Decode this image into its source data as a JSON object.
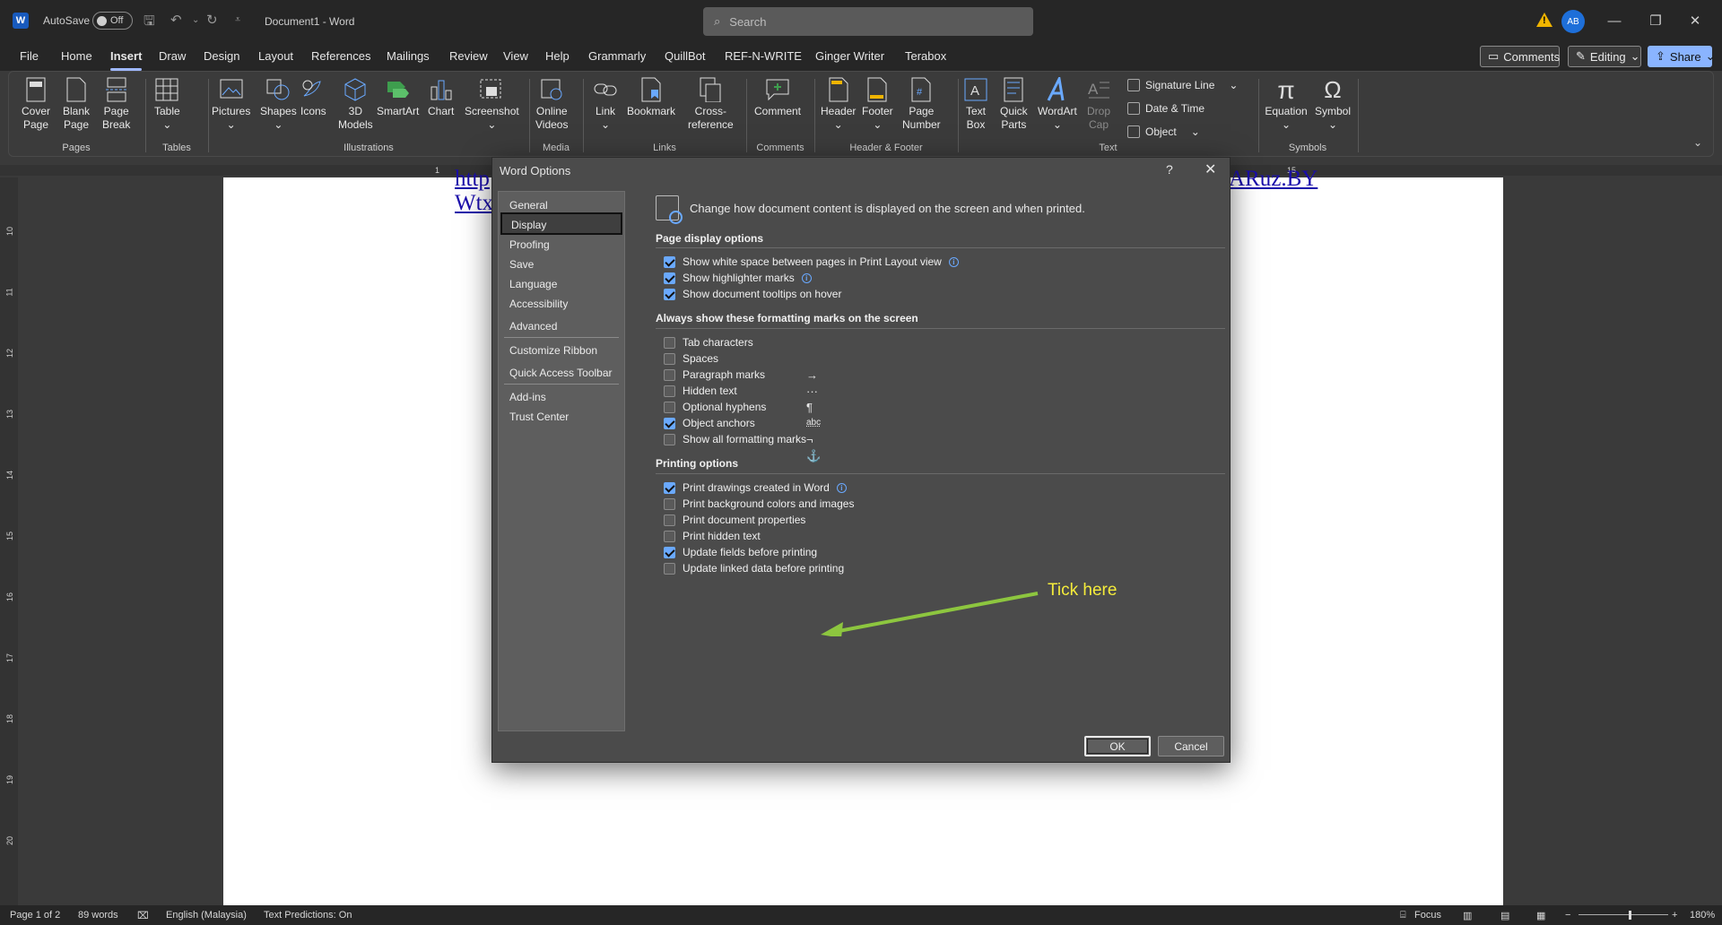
{
  "titlebar": {
    "autosave_label": "AutoSave",
    "autosave_state": "Off",
    "doc_title": "Document1  -  Word",
    "search_placeholder": "Search",
    "user_initials": "AB"
  },
  "menu": [
    "File",
    "Home",
    "Insert",
    "Draw",
    "Design",
    "Layout",
    "References",
    "Mailings",
    "Review",
    "View",
    "Help",
    "Grammarly",
    "QuillBot",
    "REF-N-WRITE",
    "Ginger Writer",
    "Terabox"
  ],
  "menu_active": "Insert",
  "menu_right": {
    "comments": "Comments",
    "editing": "Editing",
    "share": "Share"
  },
  "ribbon": {
    "groups": [
      "Pages",
      "Tables",
      "Illustrations",
      "Media",
      "Links",
      "Comments",
      "Header & Footer",
      "Text",
      "Symbols"
    ],
    "tools": {
      "cover_page": [
        "Cover",
        "Page"
      ],
      "blank_page": [
        "Blank",
        "Page"
      ],
      "page_break": [
        "Page",
        "Break"
      ],
      "table": "Table",
      "pictures": "Pictures",
      "shapes": "Shapes",
      "icons": "Icons",
      "models_3d": [
        "3D",
        "Models"
      ],
      "smartart": "SmartArt",
      "chart": "Chart",
      "screenshot": "Screenshot",
      "online_videos": [
        "Online",
        "Videos"
      ],
      "link": "Link",
      "bookmark": "Bookmark",
      "cross_reference": [
        "Cross-",
        "reference"
      ],
      "comment": "Comment",
      "header": "Header",
      "footer": "Footer",
      "page_number": [
        "Page",
        "Number"
      ],
      "text_box": [
        "Text",
        "Box"
      ],
      "quick_parts": [
        "Quick",
        "Parts"
      ],
      "wordart": "WordArt",
      "drop_cap": [
        "Drop",
        "Cap"
      ],
      "signature_line": "Signature Line",
      "date_time": "Date & Time",
      "object": "Object",
      "equation": "Equation",
      "symbol": "Symbol"
    }
  },
  "ruler": {
    "h_marks": [
      "1",
      "15"
    ],
    "v_marks": [
      "10",
      "11",
      "12",
      "13",
      "14",
      "15",
      "16",
      "17",
      "18",
      "19",
      "20"
    ]
  },
  "document": {
    "line1": "http",
    "line2": "Wtx",
    "line1_right": "ARuz.BY"
  },
  "dialog": {
    "title": "Word Options",
    "help": "?",
    "nav": [
      "General",
      "Display",
      "Proofing",
      "Save",
      "Language",
      "Accessibility",
      "Advanced",
      "Customize Ribbon",
      "Quick Access Toolbar",
      "Add-ins",
      "Trust Center"
    ],
    "nav_selected": "Display",
    "header": "Change how document content is displayed on the screen and when printed.",
    "sections": {
      "page_display": {
        "title": "Page display options",
        "options": [
          {
            "label": "Show white space between pages in Print Layout view",
            "checked": true,
            "info": true
          },
          {
            "label": "Show highlighter marks",
            "checked": true,
            "info": true
          },
          {
            "label": "Show document tooltips on hover",
            "checked": true,
            "info": false
          }
        ]
      },
      "formatting_marks": {
        "title": "Always show these formatting marks on the screen",
        "options": [
          {
            "label": "Tab characters",
            "checked": false,
            "mark": "→"
          },
          {
            "label": "Spaces",
            "checked": false,
            "mark": "···"
          },
          {
            "label": "Paragraph marks",
            "checked": false,
            "mark": "¶"
          },
          {
            "label": "Hidden text",
            "checked": false,
            "mark": "abc"
          },
          {
            "label": "Optional hyphens",
            "checked": false,
            "mark": "¬"
          },
          {
            "label": "Object anchors",
            "checked": true,
            "mark": "⚓"
          },
          {
            "label": "Show all formatting marks",
            "checked": false,
            "mark": ""
          }
        ]
      },
      "printing": {
        "title": "Printing options",
        "options": [
          {
            "label": "Print drawings created in Word",
            "checked": true,
            "info": true
          },
          {
            "label": "Print background colors and images",
            "checked": false,
            "info": false
          },
          {
            "label": "Print document properties",
            "checked": false,
            "info": false
          },
          {
            "label": "Print hidden text",
            "checked": false,
            "info": false
          },
          {
            "label": "Update fields before printing",
            "checked": true,
            "info": false
          },
          {
            "label": "Update linked data before printing",
            "checked": false,
            "info": false
          }
        ]
      }
    },
    "ok": "OK",
    "cancel": "Cancel"
  },
  "annotation": "Tick here",
  "annotation_color": "#f5ec3b",
  "arrow_color": "#8dc63f",
  "status": {
    "page": "Page 1 of 2",
    "words": "89 words",
    "language": "English (Malaysia)",
    "predictions": "Text Predictions: On",
    "focus": "Focus",
    "zoom": "180%"
  }
}
